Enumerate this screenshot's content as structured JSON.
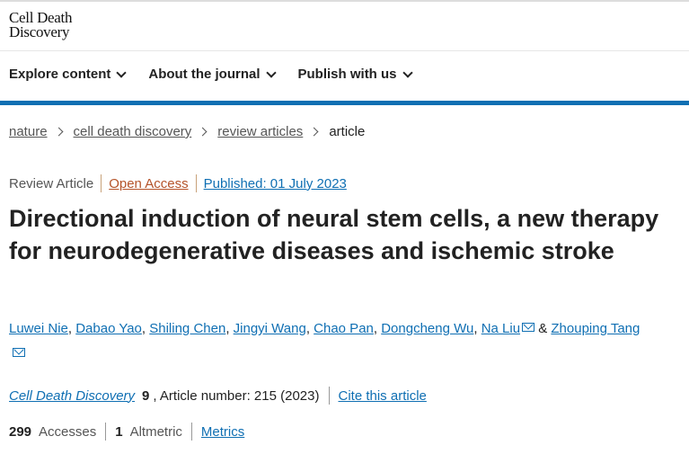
{
  "logo": {
    "line1": "Cell Death",
    "line2": "Discovery"
  },
  "nav": {
    "items": [
      {
        "label": "Explore content"
      },
      {
        "label": "About the journal"
      },
      {
        "label": "Publish with us"
      }
    ]
  },
  "breadcrumb": {
    "items": [
      "nature",
      "cell death discovery",
      "review articles"
    ],
    "current": "article"
  },
  "article": {
    "type": "Review Article",
    "access": "Open Access",
    "published": "Published: 01 July 2023",
    "title": "Directional induction of neural stem cells, a new therapy for neurodegenerative diseases and ischemic stroke",
    "authors": [
      "Luwei Nie",
      "Dabao Yao",
      "Shiling Chen",
      "Jingyi Wang",
      "Chao Pan",
      "Dongcheng Wu",
      "Na Liu",
      "Zhouping Tang"
    ],
    "author_separator": ", ",
    "author_and": " & ",
    "journal": "Cell Death Discovery",
    "volume": "9",
    "article_number": ", Article number: 215 (2023)",
    "cite_label": "Cite this article",
    "accesses_value": "299",
    "accesses_label": "Accesses",
    "altmetric_value": "1",
    "altmetric_label": "Altmetric",
    "metrics_label": "Metrics"
  }
}
